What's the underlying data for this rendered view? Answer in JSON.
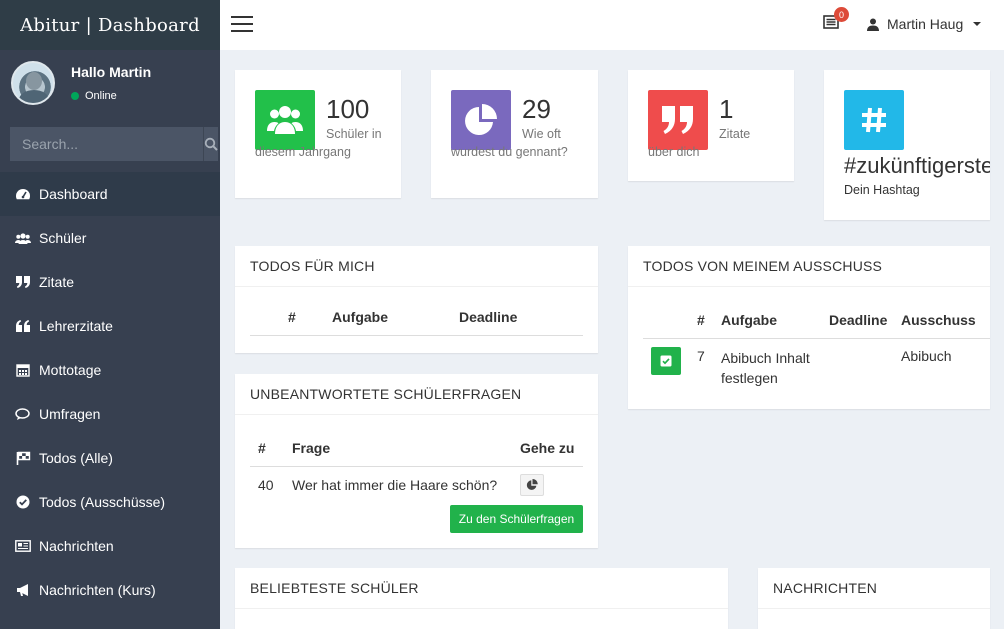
{
  "brand": {
    "title": "Abitur | Dashboard"
  },
  "user": {
    "greeting": "Hallo Martin",
    "status": "Online",
    "name": "Martin Haug"
  },
  "search": {
    "placeholder": "Search..."
  },
  "sidebar": {
    "items": [
      {
        "label": "Dashboard",
        "icon": "dashboard-icon"
      },
      {
        "label": "Schüler",
        "icon": "users-icon"
      },
      {
        "label": "Zitate",
        "icon": "quote-right-icon"
      },
      {
        "label": "Lehrerzitate",
        "icon": "quote-left-icon"
      },
      {
        "label": "Mottotage",
        "icon": "calendar-icon"
      },
      {
        "label": "Umfragen",
        "icon": "comments-icon"
      },
      {
        "label": "Todos (Alle)",
        "icon": "flag-icon"
      },
      {
        "label": "Todos (Ausschüsse)",
        "icon": "check-circle-icon"
      },
      {
        "label": "Nachrichten",
        "icon": "newspaper-icon"
      },
      {
        "label": "Nachrichten (Kurs)",
        "icon": "bullhorn-icon"
      }
    ]
  },
  "header": {
    "notification_count": "0"
  },
  "info_boxes": [
    {
      "value": "100",
      "text": "Schüler in diesem Jahrgang",
      "color": "#22c04a",
      "icon": "users-icon"
    },
    {
      "value": "29",
      "text": "Wie oft wurdest du gennant?",
      "color": "#7a69be",
      "icon": "pie-chart-icon"
    },
    {
      "value": "1",
      "text": "Zitate über dich",
      "color": "#ef4c4c",
      "icon": "quote-icon"
    },
    {
      "value": "#zukünftigerstern",
      "text": "Dein Hashtag",
      "color": "#22b8e8",
      "icon": "hashtag-icon"
    }
  ],
  "todos_me": {
    "title": "TODOS FÜR MICH",
    "headers": [
      "#",
      "Aufgabe",
      "Deadline"
    ]
  },
  "questions": {
    "title": "UNBEANTWORTETE SCHÜLERFRAGEN",
    "headers": [
      "#",
      "Frage",
      "Gehe zu"
    ],
    "rows": [
      {
        "id": "40",
        "question": "Wer hat immer die Haare schön?"
      }
    ],
    "button": "Zu den Schülerfragen"
  },
  "todos_committee": {
    "title": "TODOS VON MEINEM AUSSCHUSS",
    "headers": [
      "#",
      "Aufgabe",
      "Deadline",
      "Ausschuss"
    ],
    "rows": [
      {
        "id": "7",
        "task": "Abibuch Inhalt festlegen",
        "deadline": "",
        "committee": "Abibuch"
      }
    ]
  },
  "popular": {
    "title": "BELIEBTESTE SCHÜLER"
  },
  "messages": {
    "title": "NACHRICHTEN"
  }
}
